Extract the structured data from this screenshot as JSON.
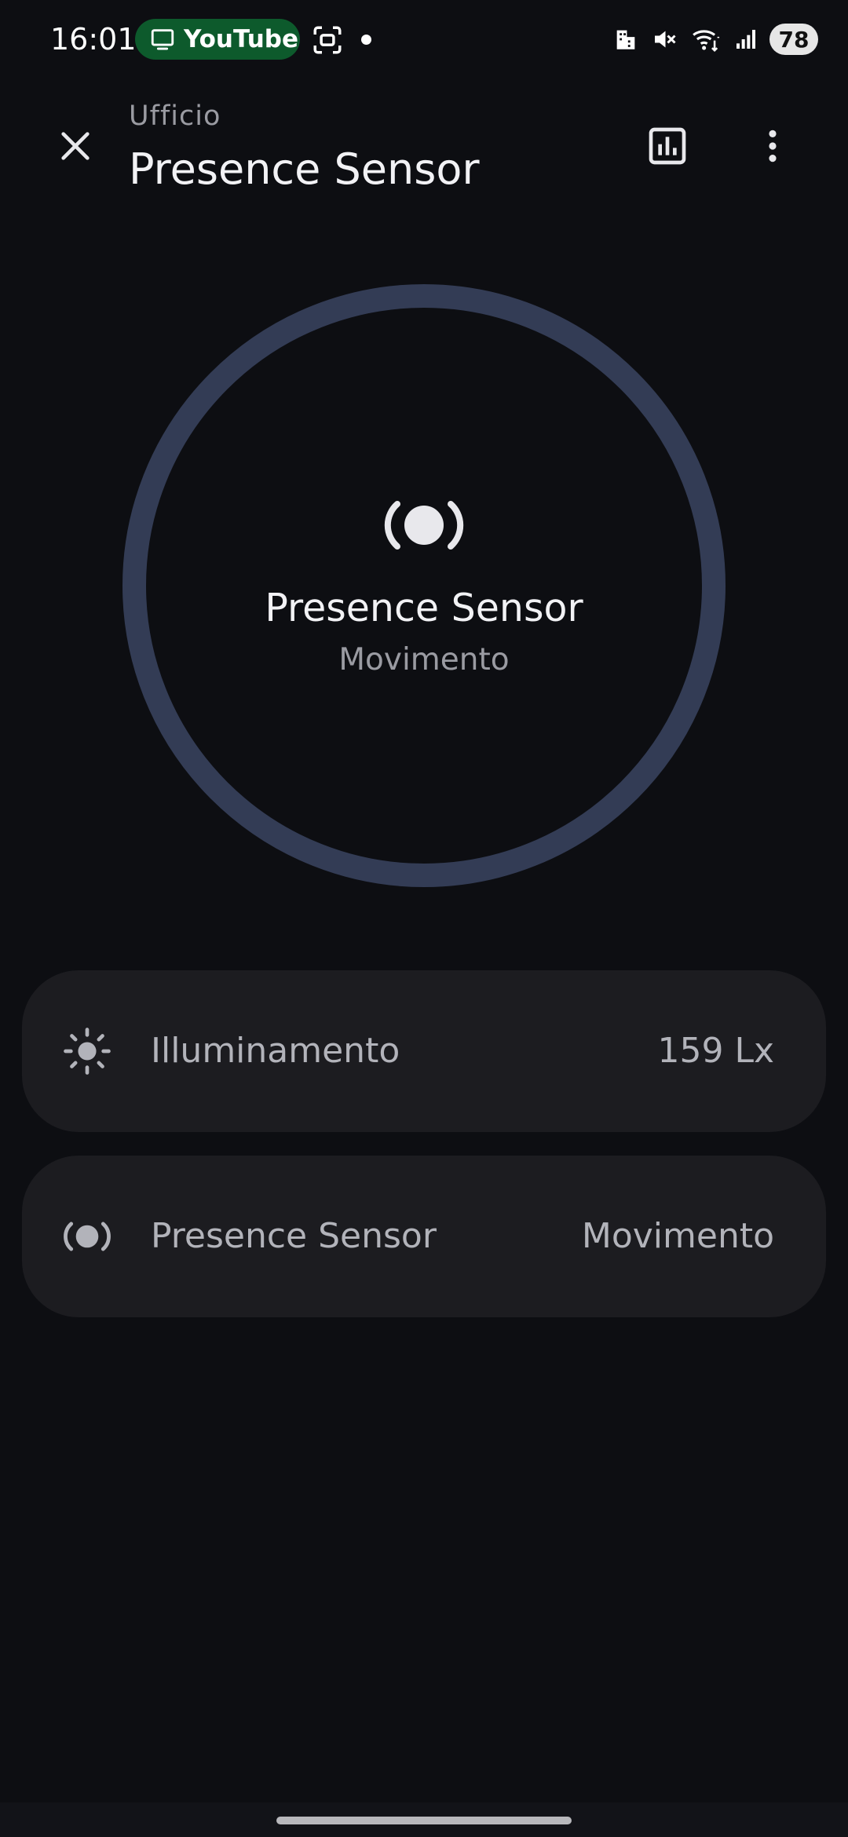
{
  "status_bar": {
    "time": "16:01",
    "active_app_pill": {
      "label": "YouTube",
      "icon": "tv-icon",
      "color": "#0d5a2c"
    },
    "cast_icon": "screen-record-icon",
    "icons": [
      "building-icon",
      "mute-icon",
      "wifi-icon",
      "signal-icon"
    ],
    "battery": "78"
  },
  "header": {
    "subtitle": "Ufficio",
    "title": "Presence Sensor",
    "close_icon": "close-icon",
    "history_icon": "bar-chart-icon",
    "more_icon": "more-vert-icon"
  },
  "main_state": {
    "title": "Presence Sensor",
    "state": "Movimento",
    "icon": "motion-sensor-icon",
    "ring_color": "#333c55"
  },
  "entities": [
    {
      "icon": "brightness-icon",
      "label": "Illuminamento",
      "value": "159 Lx"
    },
    {
      "icon": "motion-sensor-icon",
      "label": "Presence Sensor",
      "value": "Movimento"
    }
  ]
}
